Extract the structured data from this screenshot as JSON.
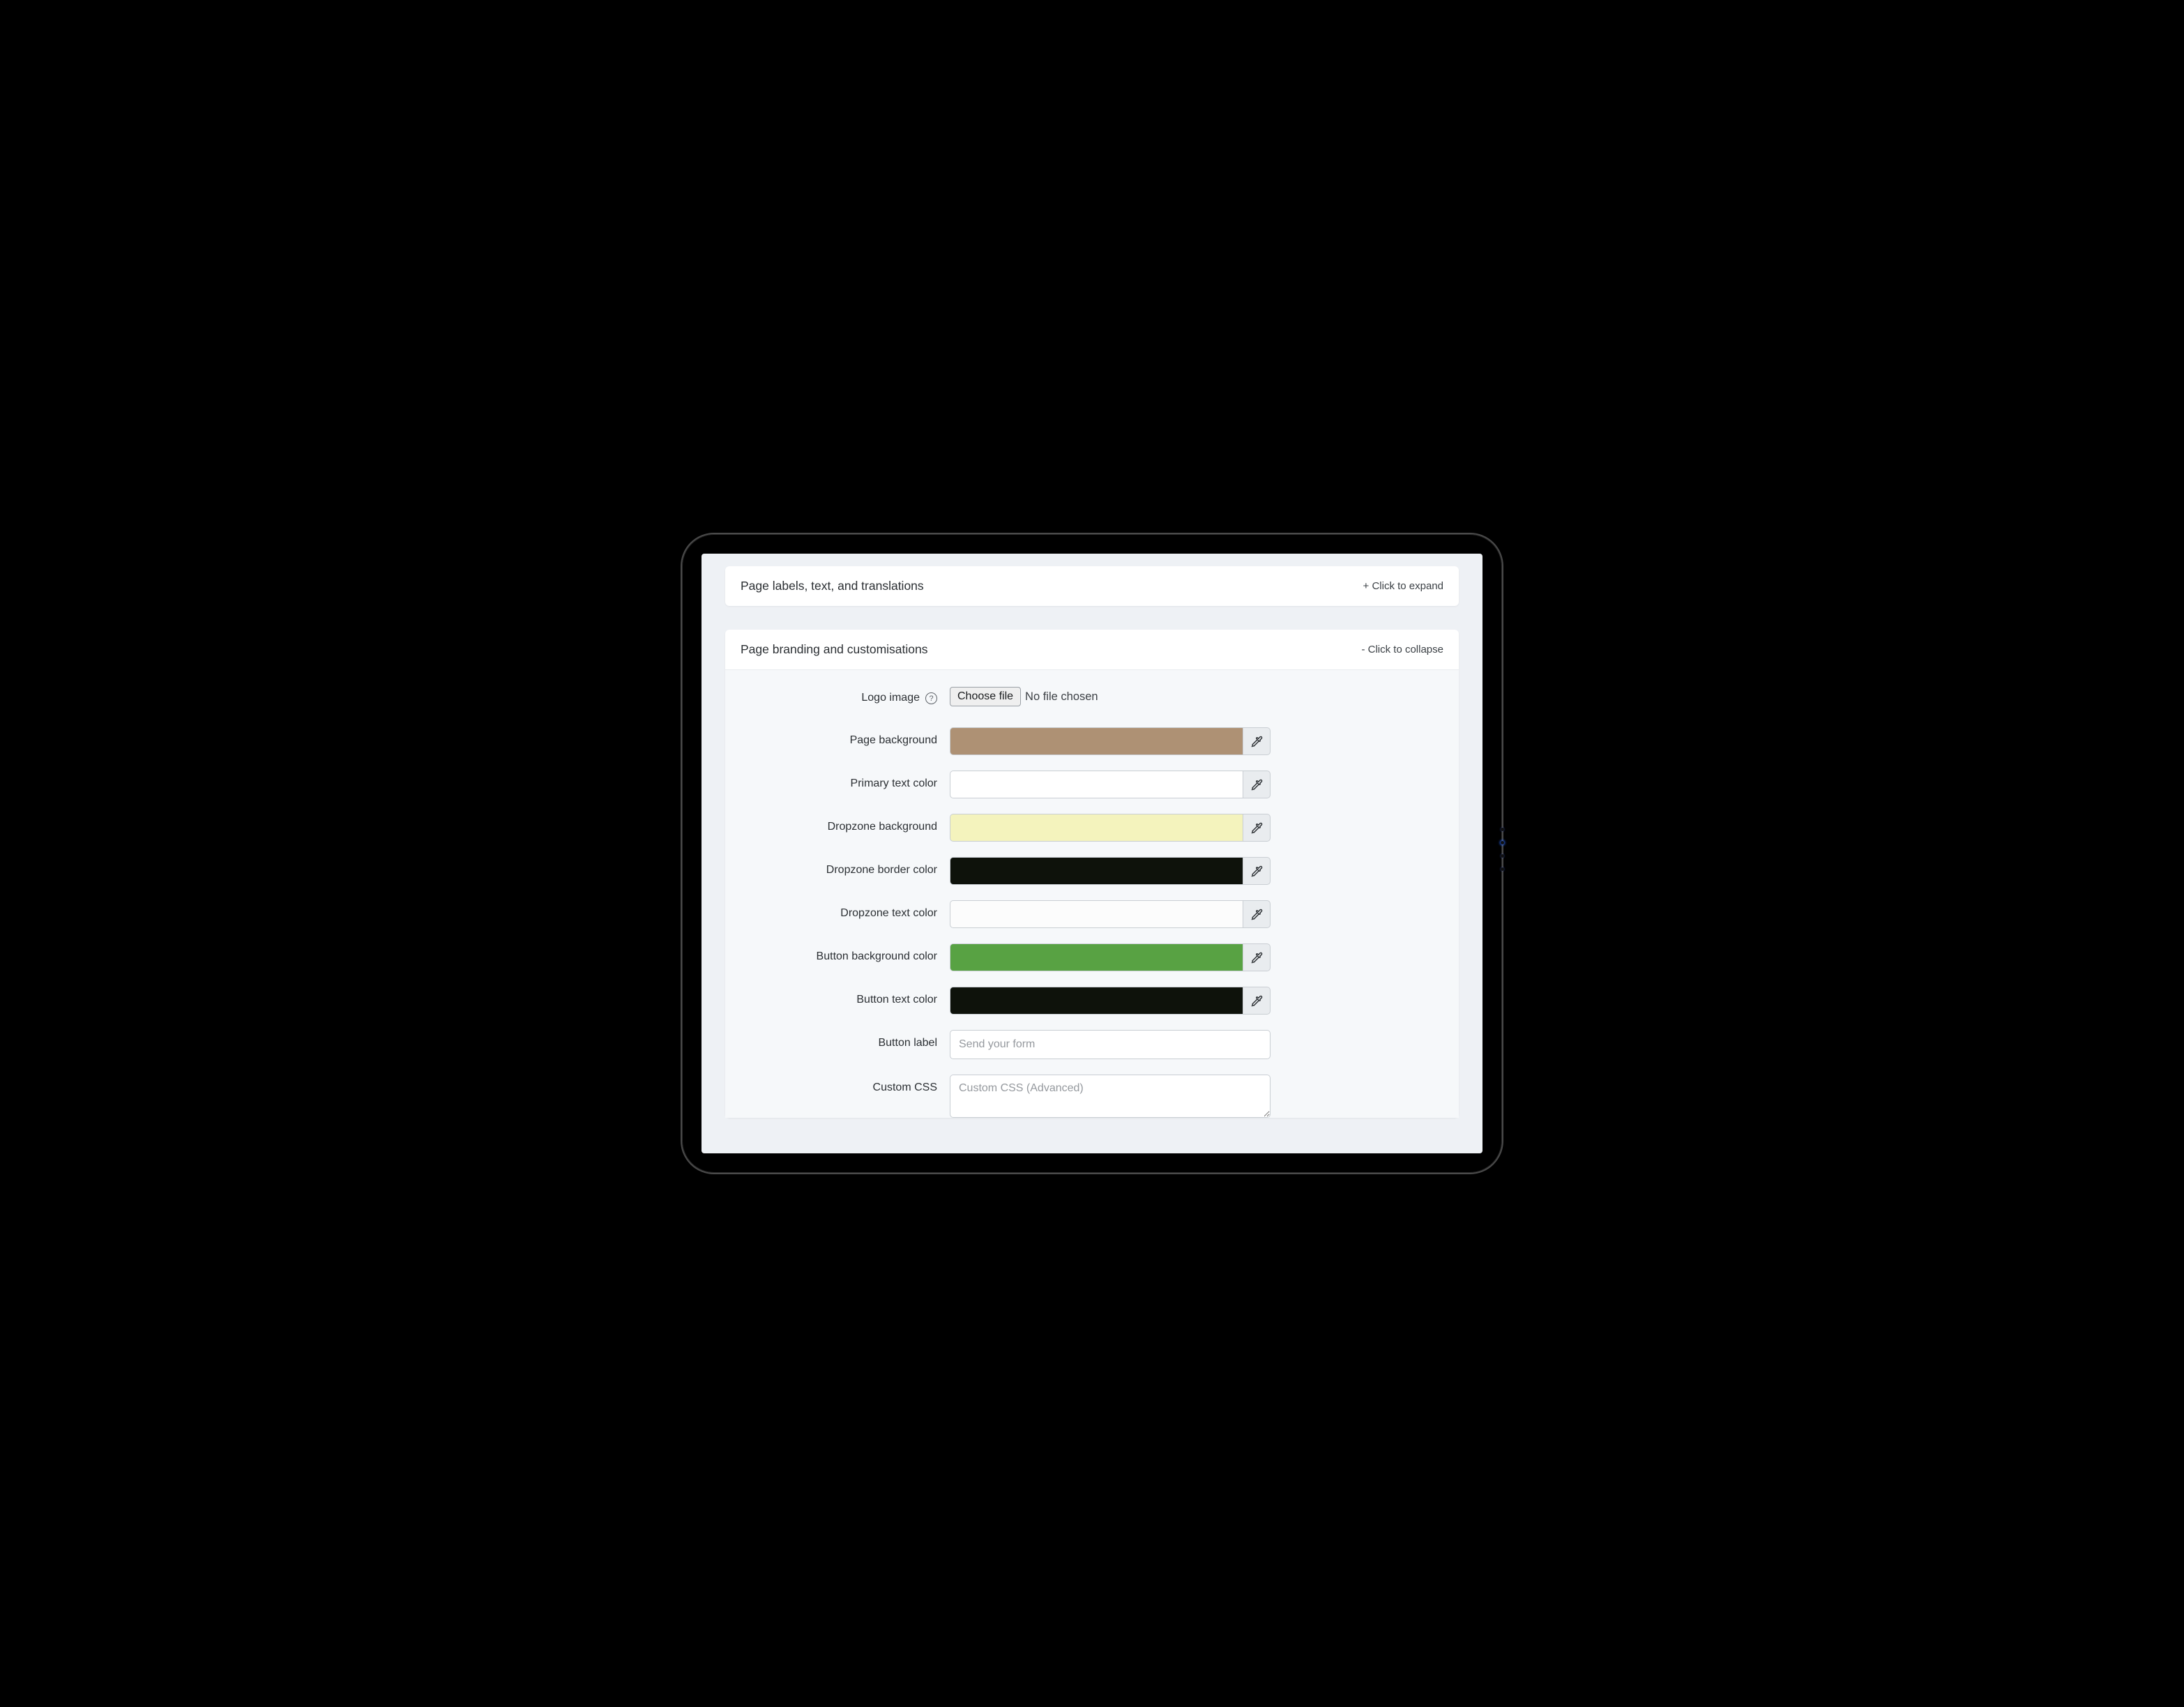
{
  "panel1": {
    "title": "Page labels, text, and translations",
    "toggle": "+ Click to expand"
  },
  "panel2": {
    "title": "Page branding and customisations",
    "toggle": "- Click to collapse"
  },
  "labels": {
    "logo_image": "Logo image",
    "page_background": "Page background",
    "primary_text_color": "Primary text color",
    "dropzone_background": "Dropzone background",
    "dropzone_border_color": "Dropzone border color",
    "dropzone_text_color": "Dropzone text color",
    "button_background_color": "Button background color",
    "button_text_color": "Button text color",
    "button_label": "Button label",
    "custom_css": "Custom CSS"
  },
  "file": {
    "choose_label": "Choose file",
    "status": "No file chosen"
  },
  "colors": {
    "page_background": "#ae9174",
    "primary_text_color": "#ffffff",
    "dropzone_background": "#f4f3bd",
    "dropzone_border_color": "#0e120b",
    "dropzone_text_color": "#fcfcfc",
    "button_background_color": "#58a243",
    "button_text_color": "#0e120b"
  },
  "inputs": {
    "button_label_placeholder": "Send your form",
    "button_label_value": "",
    "custom_css_placeholder": "Custom CSS (Advanced)",
    "custom_css_value": ""
  },
  "help_glyph": "?"
}
